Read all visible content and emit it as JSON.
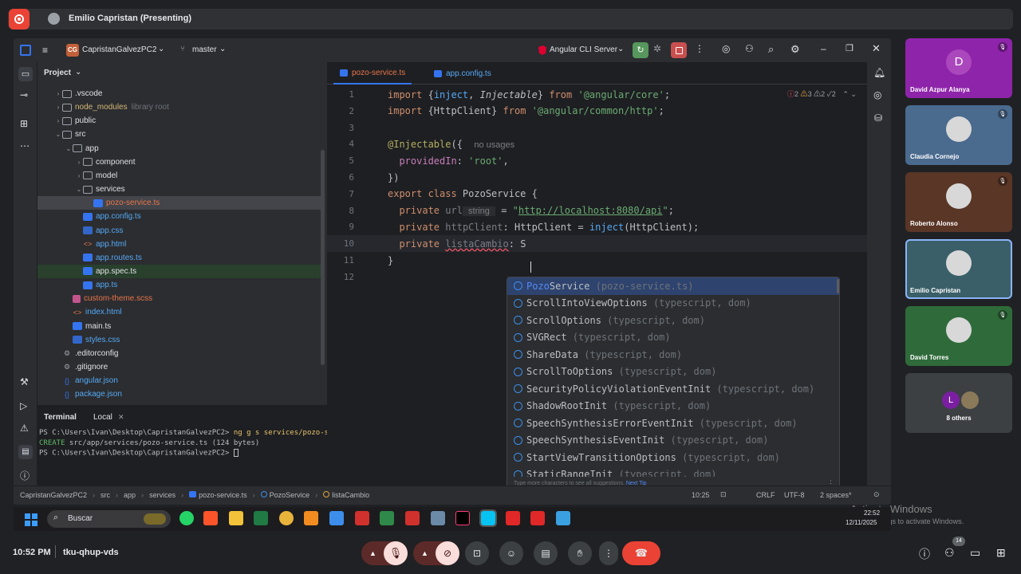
{
  "meet": {
    "presenter": "Emilio Capristan (Presenting)",
    "meeting_code": "tku-qhup-vds",
    "time": "10:52 PM",
    "participants_badge": "14",
    "participants": [
      {
        "name": "David Azpur Alanya",
        "initial": "D",
        "color": "#8e24aa",
        "muted": true
      },
      {
        "name": "Claudia Cornejo",
        "initial": "",
        "color": "#4a6a8e",
        "muted": true
      },
      {
        "name": "Roberto Alonso",
        "initial": "",
        "color": "#5a3626",
        "muted": true
      },
      {
        "name": "Emilio Capristan",
        "initial": "",
        "color": "#3a5f68",
        "muted": false
      },
      {
        "name": "David Torres",
        "initial": "",
        "color": "#2f6b3a",
        "muted": true
      },
      {
        "name": "8 others",
        "initial": "L",
        "color": "#3c4043",
        "muted": false
      }
    ]
  },
  "ide": {
    "project_badge": "CG",
    "project_name": "CapristanGalvezPC2",
    "branch": "master",
    "run_config": "Angular CLI Server",
    "panel_title": "Project",
    "tree": [
      {
        "label": ".vscode",
        "type": "folder",
        "depth": 1,
        "arrow": "›"
      },
      {
        "label": "node_modules",
        "type": "folder",
        "depth": 1,
        "arrow": "›",
        "note": "library root",
        "muted": true
      },
      {
        "label": "public",
        "type": "folder",
        "depth": 1,
        "arrow": "›"
      },
      {
        "label": "src",
        "type": "folder",
        "depth": 1,
        "arrow": "⌄"
      },
      {
        "label": "app",
        "type": "folder",
        "depth": 2,
        "arrow": "⌄"
      },
      {
        "label": "component",
        "type": "folder",
        "depth": 3,
        "arrow": "›"
      },
      {
        "label": "model",
        "type": "folder",
        "depth": 3,
        "arrow": "›"
      },
      {
        "label": "services",
        "type": "folder",
        "depth": 3,
        "arrow": "⌄"
      },
      {
        "label": "pozo-service.ts",
        "type": "ts",
        "depth": 4,
        "arrow": "",
        "selected": true,
        "color": "#e8754a"
      },
      {
        "label": "app.config.ts",
        "type": "ts",
        "depth": 3,
        "arrow": "",
        "color": "#56a8f5"
      },
      {
        "label": "app.css",
        "type": "css",
        "depth": 3,
        "arrow": "",
        "color": "#56a8f5"
      },
      {
        "label": "app.html",
        "type": "html",
        "depth": 3,
        "arrow": "",
        "color": "#56a8f5"
      },
      {
        "label": "app.routes.ts",
        "type": "ts",
        "depth": 3,
        "arrow": "",
        "color": "#56a8f5"
      },
      {
        "label": "app.spec.ts",
        "type": "ts",
        "depth": 3,
        "arrow": "",
        "green": true
      },
      {
        "label": "app.ts",
        "type": "ts",
        "depth": 3,
        "arrow": "",
        "color": "#56a8f5"
      },
      {
        "label": "custom-theme.scss",
        "type": "scss",
        "depth": 2,
        "arrow": "",
        "color": "#e8754a"
      },
      {
        "label": "index.html",
        "type": "html",
        "depth": 2,
        "arrow": "",
        "color": "#56a8f5"
      },
      {
        "label": "main.ts",
        "type": "ts",
        "depth": 2,
        "arrow": ""
      },
      {
        "label": "styles.css",
        "type": "css",
        "depth": 2,
        "arrow": "",
        "color": "#56a8f5"
      },
      {
        "label": ".editorconfig",
        "type": "cfg",
        "depth": 1,
        "arrow": ""
      },
      {
        "label": ".gitignore",
        "type": "cfg",
        "depth": 1,
        "arrow": ""
      },
      {
        "label": "angular.json",
        "type": "json",
        "depth": 1,
        "arrow": "",
        "color": "#56a8f5"
      },
      {
        "label": "package.json",
        "type": "json",
        "depth": 1,
        "arrow": "",
        "color": "#56a8f5"
      }
    ],
    "tabs": [
      {
        "label": "pozo-service.ts",
        "active": true
      },
      {
        "label": "app.config.ts",
        "active": false
      }
    ],
    "inspections": {
      "errors": "2",
      "warn1": "3",
      "warn2": "2",
      "ok": "2"
    },
    "code_lines": [
      {
        "n": "1",
        "html": "<span class='kw'>import</span> {<span class='fn'>inject</span>, <span class='it'>Injectable</span>} <span class='kw'>from</span> <span class='str'>'@angular/core'</span>;"
      },
      {
        "n": "2",
        "html": "<span class='kw'>import</span> {HttpClient} <span class='kw'>from</span> <span class='str'>'@angular/common/http'</span>;"
      },
      {
        "n": "3",
        "html": ""
      },
      {
        "n": "4",
        "html": "<span class='dec'>@Injectable</span>({  <span class='hint'>no usages</span>"
      },
      {
        "n": "5",
        "html": "  <span class='prop'>providedIn</span>: <span class='str'>'root'</span>,"
      },
      {
        "n": "6",
        "html": "})"
      },
      {
        "n": "7",
        "html": "<span class='kw'>export class</span> PozoService {"
      },
      {
        "n": "8",
        "html": "  <span class='kw'>private</span> <span style='color:#7a7e85'>url</span><span class='hint' style='background:#2b2d30;padding:0 4px'> string </span> = <span class='str'>\"<u>http://localhost:8080/api</u>\"</span>;"
      },
      {
        "n": "9",
        "html": "  <span class='kw'>private</span> <span style='color:#7a7e85'>httpClient</span>: HttpClient = <span class='fn'>inject</span>(HttpClient);"
      },
      {
        "n": "10",
        "html": "  <span class='kw'>private</span> <span style='color:#7a7e85;text-decoration:underline wavy #f75464'>listaCambio</span>: S"
      },
      {
        "n": "11",
        "html": "}"
      },
      {
        "n": "12",
        "html": ""
      }
    ],
    "suggestions": [
      {
        "match": "Pozo",
        "rest": "Service",
        "src": " (pozo-service.ts)",
        "selected": true
      },
      {
        "match": "",
        "rest": "ScrollIntoViewOptions",
        "src": " (typescript, dom)"
      },
      {
        "match": "",
        "rest": "ScrollOptions",
        "src": " (typescript, dom)"
      },
      {
        "match": "",
        "rest": "SVGRect",
        "src": " (typescript, dom)"
      },
      {
        "match": "",
        "rest": "ShareData",
        "src": " (typescript, dom)"
      },
      {
        "match": "",
        "rest": "ScrollToOptions",
        "src": " (typescript, dom)"
      },
      {
        "match": "",
        "rest": "SecurityPolicyViolationEventInit",
        "src": " (typescript, dom)"
      },
      {
        "match": "",
        "rest": "ShadowRootInit",
        "src": " (typescript, dom)"
      },
      {
        "match": "",
        "rest": "SpeechSynthesisErrorEventInit",
        "src": " (typescript, dom)"
      },
      {
        "match": "",
        "rest": "SpeechSynthesisEventInit",
        "src": " (typescript, dom)"
      },
      {
        "match": "",
        "rest": "StartViewTransitionOptions",
        "src": " (typescript, dom)"
      },
      {
        "match": "",
        "rest": "StaticRangeInit",
        "src": " (typescript, dom)"
      }
    ],
    "popup_footer": "Type more characters to see all suggestions.",
    "popup_tip": "Next Tip",
    "terminal": {
      "title": "Terminal",
      "tab": "Local",
      "lines": [
        {
          "prompt": "PS C:\\Users\\Ivan\\Desktop\\CapristanGalvezPC2> ",
          "cmd": "ng g s services/pozo-service --skip-tests",
          "kind": "cmd"
        },
        {
          "prompt": "CREATE",
          "cmd": " src/app/services/pozo-service.ts (124 bytes)",
          "kind": "create"
        },
        {
          "prompt": "PS C:\\Users\\Ivan\\Desktop\\CapristanGalvezPC2> ",
          "cmd": "",
          "kind": "prompt"
        }
      ]
    },
    "breadcrumb": [
      "CapristanGalvezPC2",
      "src",
      "app",
      "services",
      "pozo-service.ts",
      "PozoService",
      "listaCambio"
    ],
    "status": {
      "position": "10:25",
      "line_sep": "CRLF",
      "encoding": "UTF-8",
      "indent": "2 spaces*"
    }
  },
  "taskbar": {
    "search_placeholder": "Buscar",
    "clock_time": "22:52",
    "clock_date": "12/11/2025"
  },
  "activate": {
    "title": "Activate Windows",
    "sub": "Go to Settings to activate Windows."
  }
}
